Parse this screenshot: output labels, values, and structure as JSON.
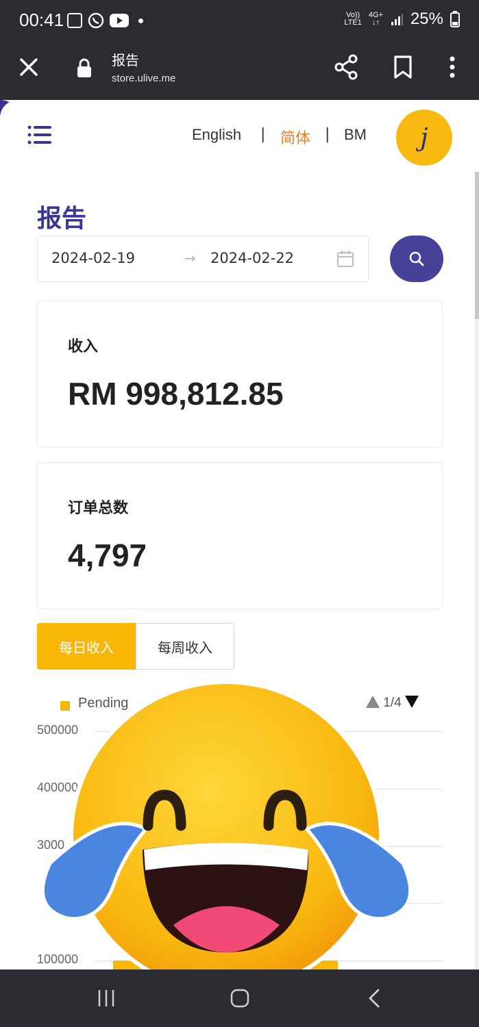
{
  "status_bar": {
    "time": "00:41",
    "network_top": "Vo))",
    "network_bottom": "LTE1",
    "data_top": "4G+",
    "data_bottom": "↓↑",
    "battery": "25%"
  },
  "browser": {
    "page_title": "报告",
    "url": "store.ulive.me",
    "icons": [
      "close-icon",
      "lock-icon",
      "share-icon",
      "bookmark-icon",
      "more-vert-icon"
    ]
  },
  "header": {
    "languages": [
      "English",
      "简体",
      "BM"
    ],
    "separator": "|",
    "active_language": "简体",
    "avatar_letter": "j"
  },
  "report": {
    "title": "报告",
    "date_start": "2024-02-19",
    "date_arrow": "→",
    "date_end": "2024-02-22"
  },
  "cards": {
    "revenue_label": "收入",
    "revenue_value": "RM 998,812.85",
    "orders_label": "订单总数",
    "orders_value": "4,797"
  },
  "tabs": {
    "daily": "每日收入",
    "weekly": "每周收入",
    "active": "daily"
  },
  "chart_data": {
    "type": "bar",
    "legend": [
      "Pending"
    ],
    "legend_pager": "1/4",
    "y_ticks": [
      "500000",
      "400000",
      "3000",
      "100000"
    ],
    "ylim": [
      0,
      500000
    ],
    "series": [
      {
        "name": "Pending",
        "values": [
          100000
        ]
      }
    ]
  },
  "colors": {
    "primary": "#47419a",
    "accent": "#f8b707",
    "active_lang": "#ef7d1a",
    "chrome": "#2b2c31"
  }
}
